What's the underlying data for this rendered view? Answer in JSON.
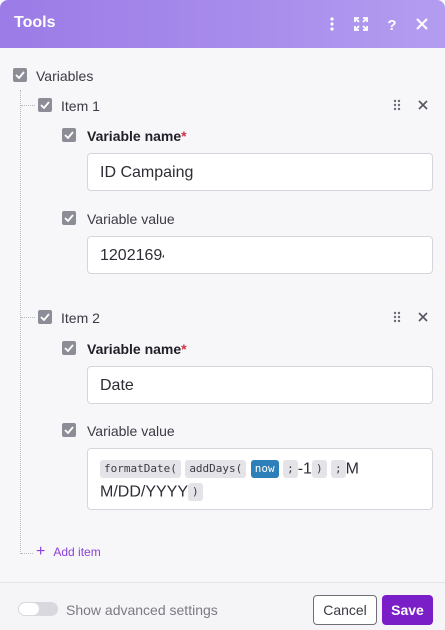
{
  "header": {
    "title": "Tools",
    "icons": [
      "more-vertical-icon",
      "expand-icon",
      "help-icon",
      "close-icon"
    ]
  },
  "variables": {
    "label": "Variables",
    "items": [
      {
        "label": "Item 1",
        "name_label": "Variable name",
        "name_value": "ID Campaing",
        "value_label": "Variable value",
        "value_value": "12021694"
      },
      {
        "label": "Item 2",
        "name_label": "Variable name",
        "name_value": "Date",
        "value_label": "Variable value",
        "expression": {
          "p1": "formatDate(",
          "p2": "addDays(",
          "kw": "now",
          "sep1": ";",
          "num": "-1",
          "close1": ")",
          "sep2": ";",
          "format_a": "M",
          "format_b": "M/DD/YYYY",
          "close2": ")"
        }
      }
    ],
    "required_mark": "*",
    "add_item": "Add item"
  },
  "footer": {
    "advanced_label": "Show advanced settings",
    "advanced_on": false,
    "cancel": "Cancel",
    "save": "Save"
  },
  "colors": {
    "header": "#a88cec",
    "save": "#7a1ec7",
    "link": "#8b3fd9",
    "keyword": "#2d7fb9"
  }
}
